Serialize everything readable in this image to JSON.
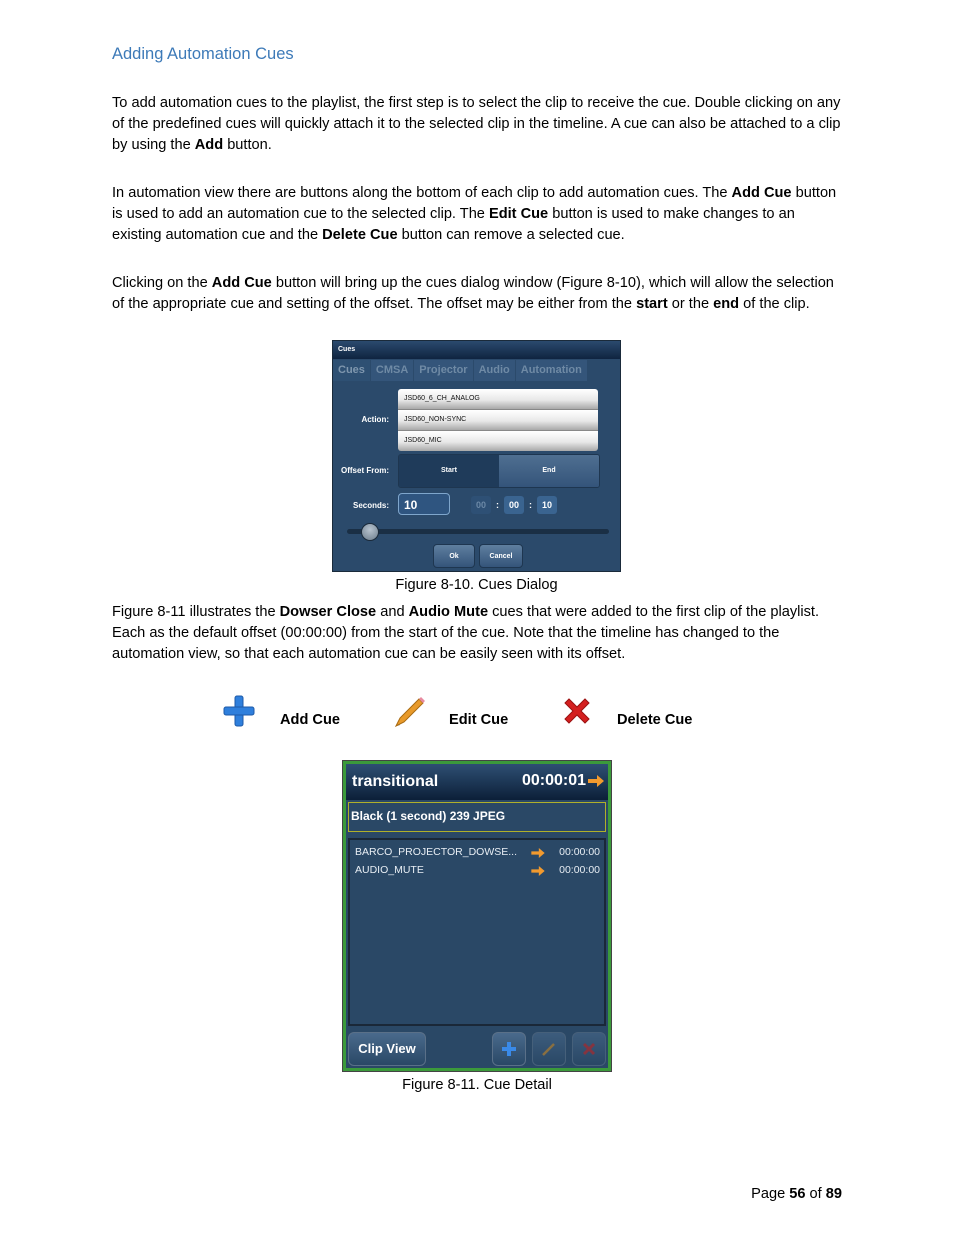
{
  "heading": "Adding Automation Cues",
  "paragraphs": {
    "p1": [
      {
        "t": "To add automation cues to the playlist, the first step is to select the clip to receive the cue.  Double clicking on any of the predefined cues will quickly attach it to the selected clip in the timeline.  A cue can also be attached to a clip by using the "
      },
      {
        "b": "Add"
      },
      {
        "t": " button."
      }
    ],
    "p2": [
      {
        "t": "In automation view there are buttons along the bottom of each clip to add automation cues.  The "
      },
      {
        "b": "Add Cue"
      },
      {
        "t": " button is used to add an automation cue to the selected clip. The "
      },
      {
        "b": "Edit Cue"
      },
      {
        "t": " button is used to make changes to an existing automation cue and the "
      },
      {
        "b": "Delete Cue"
      },
      {
        "t": " button can remove a selected cue."
      }
    ],
    "p3": [
      {
        "t": "Clicking on the "
      },
      {
        "b": "Add Cue"
      },
      {
        "t": " button will bring up the cues dialog window (Figure 8-10), which will allow the selection of the appropriate cue and setting of the offset.  The offset may be either from the "
      },
      {
        "b": "start"
      },
      {
        "t": " or the "
      },
      {
        "b": "end"
      },
      {
        "t": " of the clip."
      }
    ],
    "p4": [
      {
        "t": "Figure 8-11 illustrates the "
      },
      {
        "b": "Dowser Close"
      },
      {
        "t": " and "
      },
      {
        "b": "Audio Mute"
      },
      {
        "t": " cues that were added to the first clip of the playlist.  Each as the default offset (00:00:00) from the start of the cue.  Note that the timeline has changed to the automation view, so that each automation cue can be easily seen with its offset."
      }
    ]
  },
  "cues_dialog": {
    "title": "Cues",
    "tabs": [
      "Cues",
      "CMSA",
      "Projector",
      "Audio",
      "Automation"
    ],
    "active_tab": "Cues",
    "action_label": "Action:",
    "actions": [
      "JSD60_6_CH_ANALOG",
      "JSD60_NON-SYNC",
      "JSD60_MIC"
    ],
    "offset_label": "Offset From:",
    "offset_options": [
      "Start",
      "End"
    ],
    "offset_selected": "End",
    "seconds_label": "Seconds:",
    "seconds_value": "10",
    "time_hours": "00",
    "time_minutes": "00",
    "time_seconds": "10",
    "ok_label": "Ok",
    "cancel_label": "Cancel"
  },
  "caption_1": "Figure 8-10.  Cues Dialog",
  "legend": {
    "add": {
      "icon": "plus-icon",
      "label": "Add Cue",
      "color": "#2f7fdc"
    },
    "edit": {
      "icon": "pencil-icon",
      "label": "Edit Cue",
      "color": "#e89a2a"
    },
    "delete": {
      "icon": "x-icon",
      "label": "Delete Cue",
      "color": "#d42020"
    }
  },
  "cue_detail": {
    "clip_name": "transitional",
    "clip_time": "00:00:01",
    "clip_description": "Black (1 second) 239 JPEG",
    "cues": [
      {
        "name": "BARCO_PROJECTOR_DOWSE...",
        "offset": "00:00:00"
      },
      {
        "name": "AUDIO_MUTE",
        "offset": "00:00:00"
      }
    ],
    "clip_view_label": "Clip View",
    "border_color": "#3b9a3b"
  },
  "caption_2": "Figure 8-11.  Cue Detail",
  "footer": {
    "prefix": "Page ",
    "page": "56",
    "middle": " of ",
    "total": "89"
  }
}
